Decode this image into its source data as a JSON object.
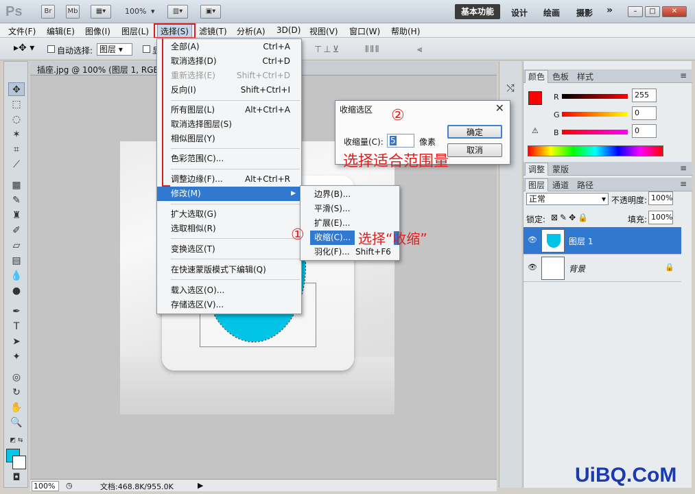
{
  "titlebar": {
    "logo": "Ps",
    "bridge": "Br",
    "minibridge": "Mb",
    "zoom": "100%",
    "workspaces": [
      "基本功能",
      "设计",
      "绘画",
      "摄影"
    ],
    "more": "»"
  },
  "menubar": [
    "文件(F)",
    "编辑(E)",
    "图像(I)",
    "图层(L)",
    "选择(S)",
    "滤镜(T)",
    "分析(A)",
    "3D(D)",
    "视图(V)",
    "窗口(W)",
    "帮助(H)"
  ],
  "options": {
    "auto_select_label": "自动选择:",
    "auto_select_value": "图层",
    "show_transform_partial": "显"
  },
  "document": {
    "tab_title": "插座.jpg @ 100% (图层 1, RGB/8",
    "status_zoom": "100%",
    "status_doc": "文档:468.8K/955.0K"
  },
  "select_menu": [
    {
      "label": "全部(A)",
      "shortcut": "Ctrl+A"
    },
    {
      "label": "取消选择(D)",
      "shortcut": "Ctrl+D"
    },
    {
      "label": "重新选择(E)",
      "shortcut": "Shift+Ctrl+D",
      "disabled": true
    },
    {
      "label": "反向(I)",
      "shortcut": "Shift+Ctrl+I"
    },
    {
      "label": "所有图层(L)",
      "shortcut": "Alt+Ctrl+A"
    },
    {
      "label": "取消选择图层(S)",
      "shortcut": ""
    },
    {
      "label": "相似图层(Y)",
      "shortcut": ""
    },
    {
      "label": "色彩范围(C)...",
      "shortcut": ""
    },
    {
      "label": "调整边缘(F)...",
      "shortcut": "Alt+Ctrl+R"
    },
    {
      "label": "修改(M)",
      "shortcut": ""
    },
    {
      "label": "扩大选取(G)",
      "shortcut": ""
    },
    {
      "label": "选取相似(R)",
      "shortcut": ""
    },
    {
      "label": "变换选区(T)",
      "shortcut": ""
    },
    {
      "label": "在快速蒙版模式下编辑(Q)",
      "shortcut": ""
    },
    {
      "label": "载入选区(O)...",
      "shortcut": ""
    },
    {
      "label": "存储选区(V)...",
      "shortcut": ""
    }
  ],
  "modify_submenu": [
    {
      "label": "边界(B)...",
      "shortcut": ""
    },
    {
      "label": "平滑(S)...",
      "shortcut": ""
    },
    {
      "label": "扩展(E)...",
      "shortcut": ""
    },
    {
      "label": "收缩(C)...",
      "shortcut": ""
    },
    {
      "label": "羽化(F)...",
      "shortcut": "Shift+F6"
    }
  ],
  "dialog": {
    "title": "收缩选区",
    "close": "✕",
    "amount_label": "收缩量(C):",
    "amount_value": "5",
    "unit": "像素",
    "ok": "确定",
    "cancel": "取消"
  },
  "annotations": {
    "step1": "①",
    "step1_text": "选择“收缩”",
    "step2": "②",
    "step2_text": "选择适合范围量"
  },
  "color_panel": {
    "tabs": [
      "颜色",
      "色板",
      "样式"
    ],
    "r_label": "R",
    "r_value": "255",
    "g_label": "G",
    "g_value": "0",
    "b_label": "B",
    "b_value": "0",
    "fg_color": "#ff0000"
  },
  "adjust_panel": {
    "tabs": [
      "调整",
      "蒙版"
    ]
  },
  "layers_panel": {
    "tabs": [
      "图层",
      "通道",
      "路径"
    ],
    "blend_mode": "正常",
    "opacity_label": "不透明度:",
    "opacity_value": "100%",
    "lock_label": "锁定:",
    "fill_label": "填充:",
    "fill_value": "100%",
    "layers": [
      {
        "name": "图层 1",
        "selected": true
      },
      {
        "name": "背景",
        "selected": false
      }
    ]
  },
  "toolbox": {
    "fg_color": "#00c8ea",
    "bg_color": "#ffffff"
  },
  "watermark": "UiBQ.CoM"
}
